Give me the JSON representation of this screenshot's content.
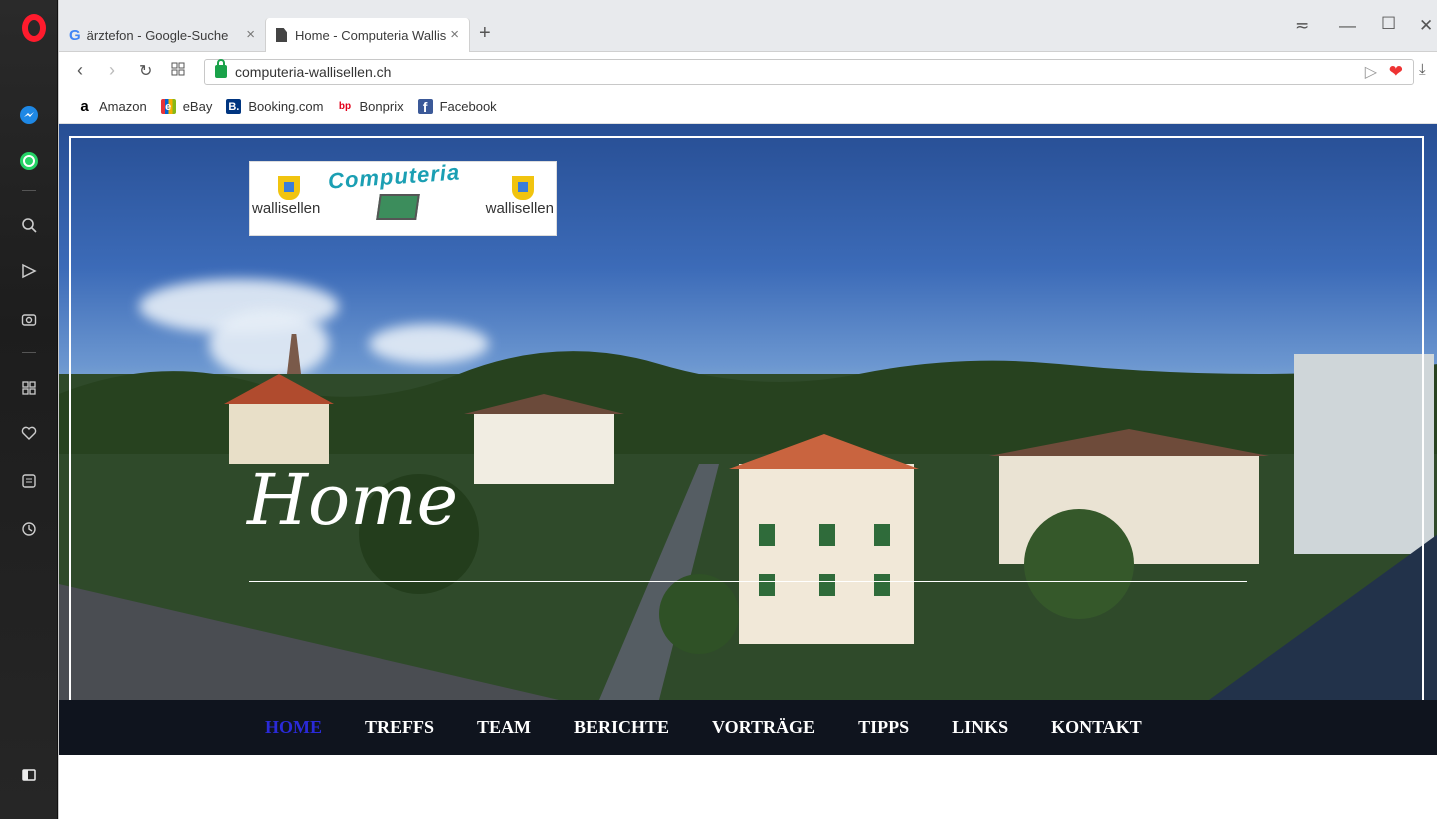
{
  "browser": {
    "tabs": [
      {
        "label": "ärztefon - Google-Suche",
        "favicon": "google-g-icon"
      },
      {
        "label": "Home - Computeria Wallis",
        "favicon": "document-icon",
        "active": true
      }
    ],
    "new_tab": "+",
    "url": "computeria-wallisellen.ch",
    "bookmarks": [
      {
        "label": "Amazon",
        "icon": "amazon-icon",
        "icon_text": "a",
        "color": "#000000"
      },
      {
        "label": "eBay",
        "icon": "ebay-icon",
        "icon_text": "e",
        "color": "#e53238"
      },
      {
        "label": "Booking.com",
        "icon": "booking-icon",
        "icon_text": "B.",
        "color": "#003580"
      },
      {
        "label": "Bonprix",
        "icon": "bonprix-icon",
        "icon_text": "bp",
        "color": "#e2001a"
      },
      {
        "label": "Facebook",
        "icon": "facebook-icon",
        "icon_text": "f",
        "color": "#3b5998"
      }
    ]
  },
  "logo": {
    "title": "Computeria",
    "left_text": "wallisellen",
    "right_text": "wallisellen"
  },
  "hero": {
    "title": "Home"
  },
  "nav": {
    "items": [
      "HOME",
      "TREFFS",
      "TEAM",
      "BERICHTE",
      "VORTRÄGE",
      "TIPPS",
      "LINKS",
      "KONTAKT"
    ],
    "active_index": 0,
    "active_color": "#2a2ad8"
  },
  "sidebar": {
    "icons": [
      "opera-logo-icon",
      "messenger-icon",
      "whatsapp-icon",
      "search-icon",
      "send-icon",
      "camera-icon",
      "speed-dial-icon",
      "heart-icon",
      "news-icon",
      "history-icon",
      "sidebar-toggle-icon"
    ]
  }
}
